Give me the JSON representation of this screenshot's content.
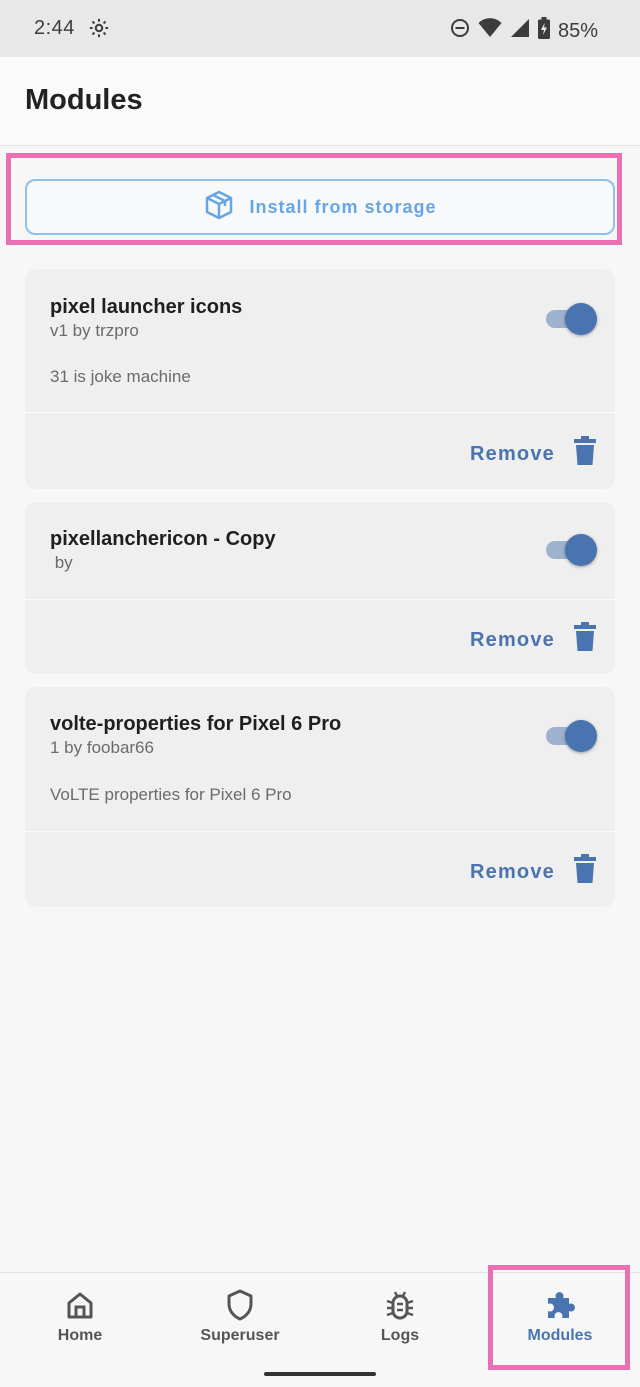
{
  "status_bar": {
    "time": "2:44",
    "battery": "85%"
  },
  "header": {
    "title": "Modules"
  },
  "install_button": {
    "label": "Install from storage"
  },
  "modules": [
    {
      "name": "pixel launcher icons",
      "meta": "v1 by trzpro",
      "description": "31 is joke machine",
      "enabled": true,
      "remove_label": "Remove"
    },
    {
      "name": "pixellanchericon - Copy",
      "meta": " by",
      "description": "",
      "enabled": true,
      "remove_label": "Remove"
    },
    {
      "name": "volte-properties for Pixel 6 Pro",
      "meta": "1 by foobar66",
      "description": "VoLTE properties for Pixel 6 Pro",
      "enabled": true,
      "remove_label": "Remove"
    }
  ],
  "bottom_nav": {
    "items": [
      {
        "label": "Home",
        "icon": "home-icon"
      },
      {
        "label": "Superuser",
        "icon": "shield-icon"
      },
      {
        "label": "Logs",
        "icon": "bug-icon"
      },
      {
        "label": "Modules",
        "icon": "puzzle-icon",
        "active": true
      }
    ]
  },
  "colors": {
    "accent": "#4a74b0",
    "install_accent": "#67a6e3",
    "highlight": "#ea6fb3",
    "card_bg": "#efefef"
  }
}
